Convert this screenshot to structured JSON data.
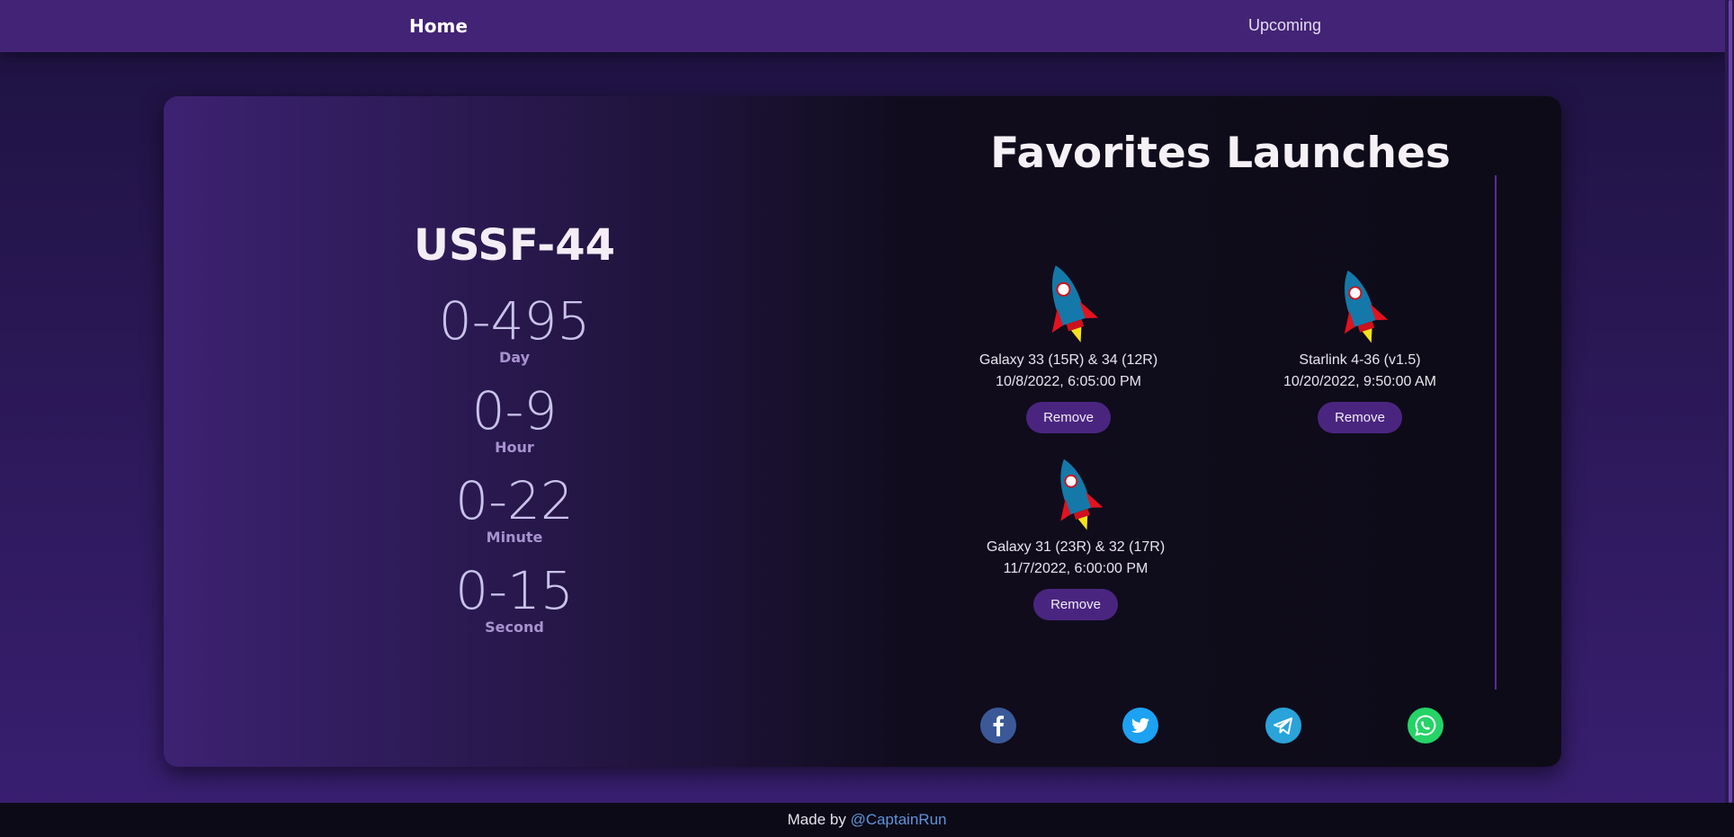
{
  "nav": {
    "home_label": "Home",
    "upcoming_label": "Upcoming"
  },
  "countdown": {
    "mission": "USSF-44",
    "units": [
      {
        "value": "0-495",
        "label": "Day"
      },
      {
        "value": "0-9",
        "label": "Hour"
      },
      {
        "value": "0-22",
        "label": "Minute"
      },
      {
        "value": "0-15",
        "label": "Second"
      }
    ]
  },
  "favorites": {
    "title": "Favorites Launches",
    "items": [
      {
        "name": "Galaxy 33 (15R) & 34 (12R)",
        "date": "10/8/2022, 6:05:00 PM",
        "remove_label": "Remove",
        "icon": "rocket-icon"
      },
      {
        "name": "Starlink 4-36 (v1.5)",
        "date": "10/20/2022, 9:50:00 AM",
        "remove_label": "Remove",
        "icon": "rocket-icon"
      },
      {
        "name": "Galaxy 31 (23R) & 32 (17R)",
        "date": "11/7/2022, 6:00:00 PM",
        "remove_label": "Remove",
        "icon": "rocket-icon"
      }
    ]
  },
  "social": [
    {
      "icon": "facebook-icon",
      "color": "#3b5998"
    },
    {
      "icon": "twitter-icon",
      "color": "#1da1f2"
    },
    {
      "icon": "telegram-icon",
      "color": "#2aa3d9"
    },
    {
      "icon": "whatsapp-icon",
      "color": "#25d366"
    }
  ],
  "footer": {
    "text": "Made by",
    "link": "@CaptainRun"
  },
  "colors": {
    "nav_bg": "#432375",
    "button_bg": "#4a2580",
    "link": "#5f93d9"
  }
}
